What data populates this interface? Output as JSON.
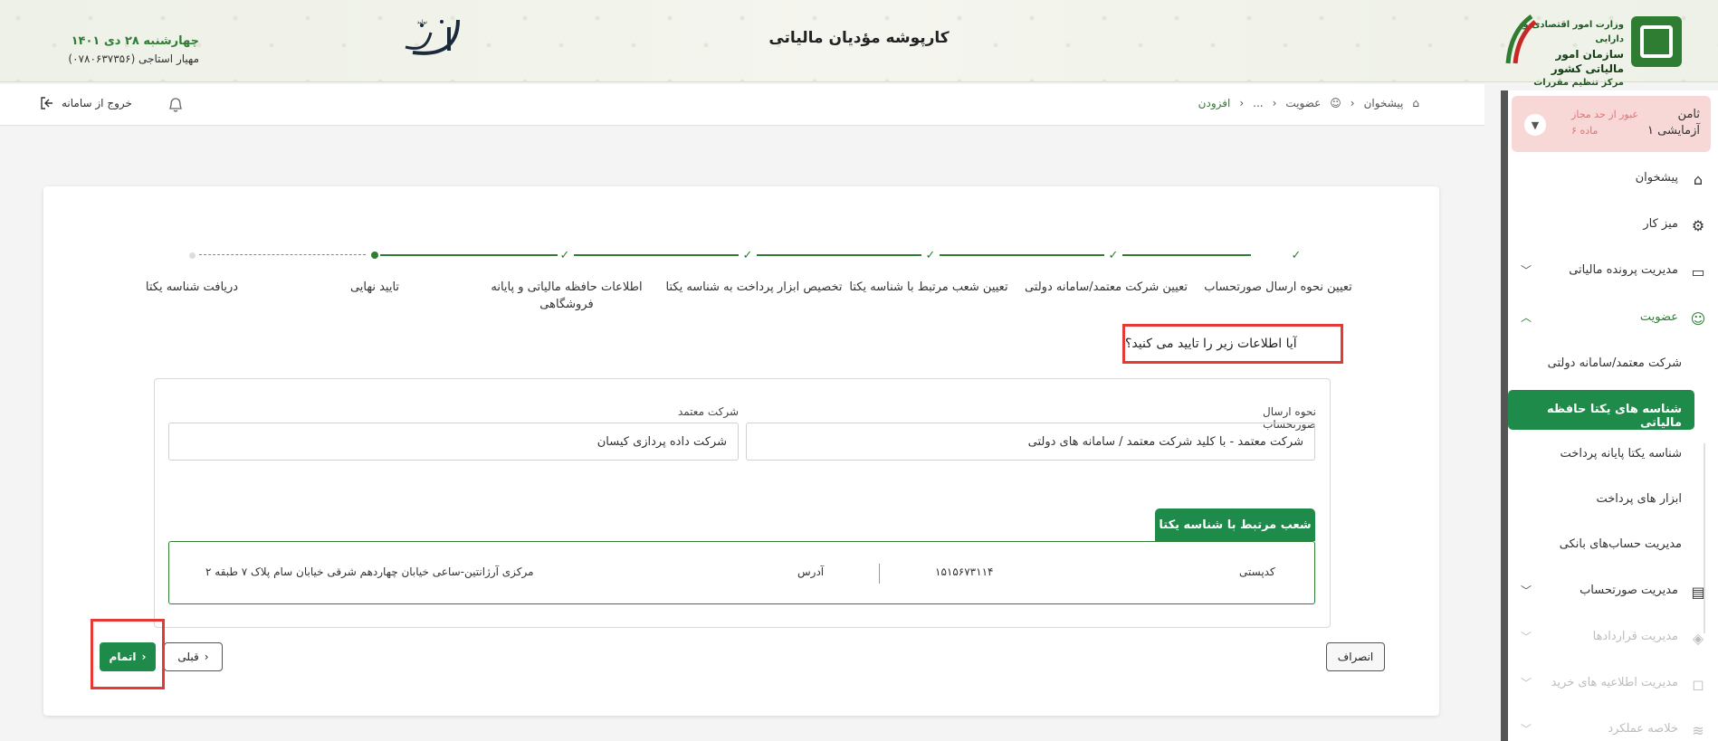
{
  "header": {
    "app_title": "کارپوشه مؤدیان مالیاتی",
    "org_line1": "وزارت امور اقتصادی و دارایی",
    "org_line2": "سازمان امور مالیاتی کشور",
    "org_line3": "مرکز تنظیم مقررات",
    "date": "چهارشنبه ۲۸ دی ۱۴۰۱",
    "user": "مهیار استاجی (۰۷۸۰۶۳۷۳۵۶)",
    "tolid_logo_text": "تولید"
  },
  "topbar": {
    "breadcrumb": [
      "پیشخوان",
      "عضویت",
      "...",
      "افزودن"
    ],
    "logout_label": "خروج از سامانه"
  },
  "sidebar": {
    "user_name_1": "ثامن",
    "user_name_2": "آزمایشی ۱",
    "user_warning_1": "عبور از حد مجاز",
    "user_warning_2": "ماده ۶",
    "items": [
      {
        "label": "پیشخوان",
        "icon": "home-icon"
      },
      {
        "label": "میز کار",
        "icon": "workspace-icon"
      },
      {
        "label": "مدیریت پرونده مالیاتی",
        "icon": "file-icon"
      },
      {
        "label": "عضویت",
        "icon": "user-icon"
      },
      {
        "label": "مدیریت صورتحساب",
        "icon": "invoice-icon"
      },
      {
        "label": "مدیریت قراردادها",
        "icon": "contract-icon"
      },
      {
        "label": "مدیریت اطلاعیه های خرید",
        "icon": "bag-icon"
      },
      {
        "label": "خلاصه عملکرد",
        "icon": "chart-icon"
      }
    ],
    "sub_items": [
      "شرکت معتمد/سامانه دولتی",
      "شناسه های یکتا حافظه مالیاتی",
      "شناسه یکتا پایانه پرداخت",
      "ابزار های پرداخت",
      "مدیریت حساب‌های بانکی"
    ]
  },
  "stepper": {
    "steps": [
      "تعیین نحوه ارسال صورتحساب",
      "تعیین شرکت معتمد/سامانه دولتی",
      "تعیین شعب مرتبط با شناسه یکتا",
      "تخصیص ابزار پرداخت به شناسه یکتا",
      "اطلاعات حافظه مالیاتی و پایانه",
      "تایید نهایی",
      "دریافت شناسه یکتا"
    ],
    "step5_line2": "فروشگاهی"
  },
  "form": {
    "question": "آیا اطلاعات زیر را تایید می کنید؟",
    "send_method_label": "نحوه ارسال صورتحساب",
    "send_method_value": "شرکت معتمد - با کلید شرکت معتمد / سامانه های دولتی",
    "trusted_company_label": "شرکت معتمد",
    "trusted_company_value": "شرکت داده پردازی کیسان",
    "branches_tab": "شعب مرتبط با شناسه یکتا",
    "branch": {
      "postal_code_label": "کدپستی",
      "postal_code_value": "۱۵۱۵۶۷۳۱۱۴",
      "address_label": "آدرس",
      "address_value": "مرکزی آرژانتین-ساعی خیابان چهاردهم شرقی خیابان سام پلاک ۷ طبقه ۲"
    }
  },
  "buttons": {
    "cancel": "انصراف",
    "prev": "قبلی",
    "finish": "اتمام"
  },
  "colors": {
    "primary_green": "#1e8b4b",
    "highlight_red": "#e53935",
    "warning_card": "#f8d7d7"
  }
}
